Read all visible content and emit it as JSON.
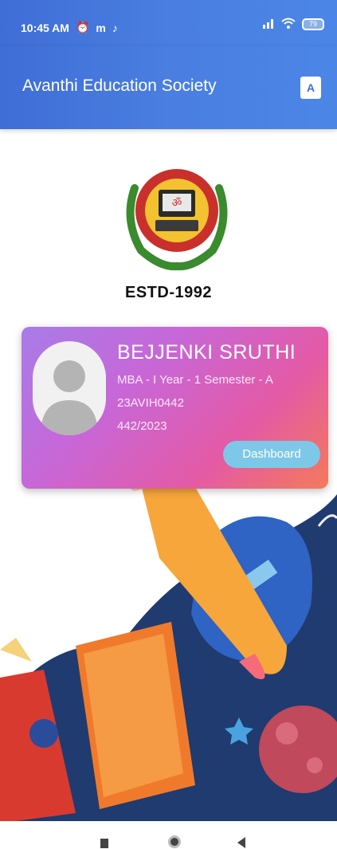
{
  "status_bar": {
    "time": "10:45 AM",
    "icons": [
      "alarm-icon",
      "m-icon",
      "music-note-icon"
    ],
    "right_icons": [
      "signal-icon",
      "wifi-icon"
    ],
    "battery": "79"
  },
  "app_bar": {
    "title": "Avanthi Education Society",
    "translate_icon": "translate-icon",
    "color": "#4a7ee0"
  },
  "logo": {
    "estd": "ESTD-1992"
  },
  "profile": {
    "name": "BEJJENKI SRUTHI",
    "course": "MBA - I Year - 1 Semester - A",
    "roll_no": "23AVIH0442",
    "admission_no": "442/2023",
    "dashboard_label": "Dashboard"
  },
  "nav": {
    "recents": "recents-icon",
    "home": "home-icon",
    "back": "back-icon"
  }
}
